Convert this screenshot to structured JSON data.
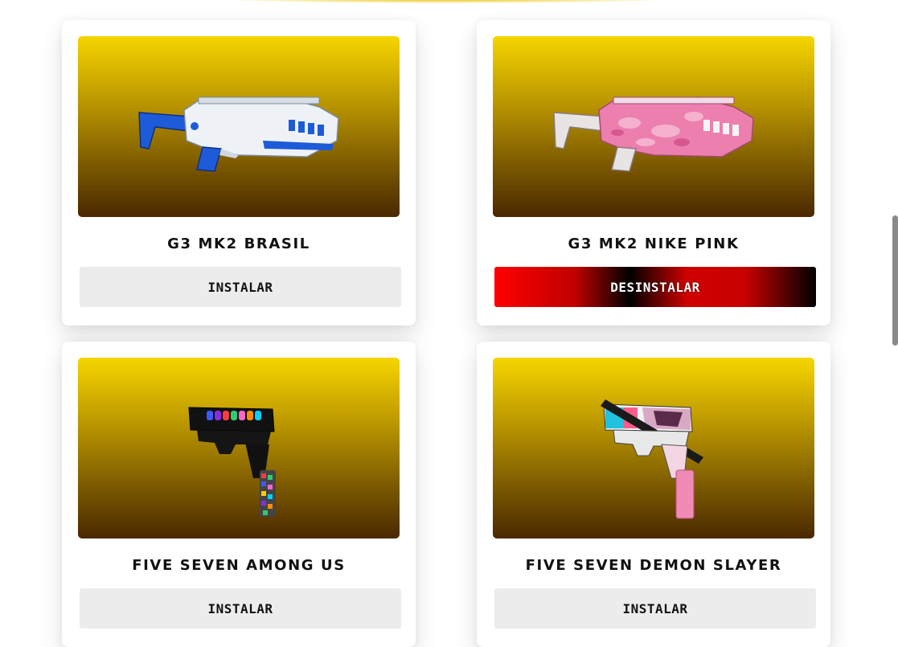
{
  "products": [
    {
      "name": "G3 MK2 BRASIL",
      "button_label": "INSTALAR",
      "image_icon": "rifle-icon"
    },
    {
      "name": "G3 MK2 NIKE PINK",
      "button_label": "DESINSTALAR",
      "image_icon": "rifle-icon"
    },
    {
      "name": "FIVE SEVEN AMONG US",
      "button_label": "INSTALAR",
      "image_icon": "pistol-icon"
    },
    {
      "name": "FIVE SEVEN DEMON SLAYER",
      "button_label": "INSTALAR",
      "image_icon": "pistol-icon"
    }
  ],
  "colors": {
    "card_gradient_top": "#f6d500",
    "card_gradient_bottom": "#4a2800",
    "install_button_bg": "#ececec",
    "uninstall_button_red": "#ff0000",
    "uninstall_button_black": "#000000",
    "brasil_blue": "#1e5bd8",
    "nike_pink": "#ec7fae",
    "demon_pink": "#f08bb5"
  }
}
